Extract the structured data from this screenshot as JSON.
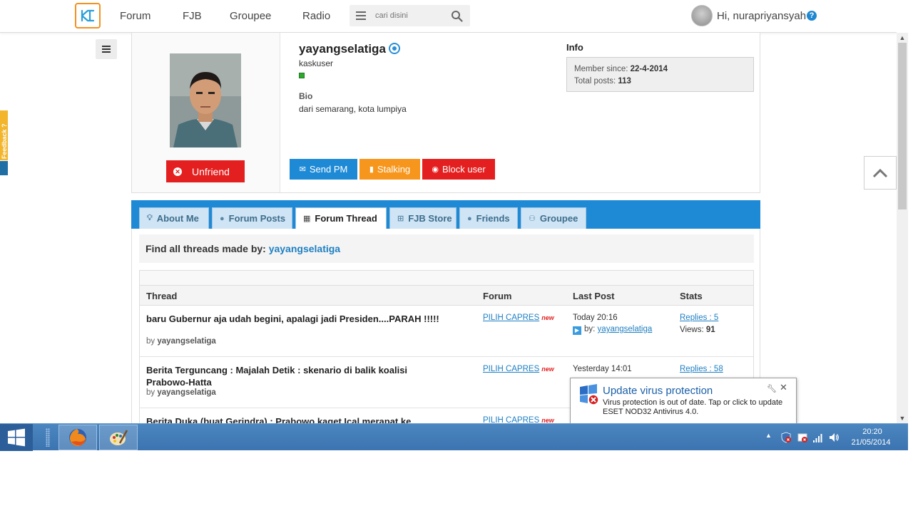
{
  "nav": {
    "forum": "Forum",
    "fjb": "FJB",
    "groupee": "Groupee",
    "radio": "Radio",
    "search_placeholder": "cari disini",
    "greeting": "Hi, nurapriyansyah",
    "help": "?"
  },
  "feedback": {
    "label": "Feedback ?"
  },
  "profile": {
    "name": "yayangselatiga",
    "rank": "kaskuser",
    "bio_label": "Bio",
    "bio": "dari semarang, kota lumpiya",
    "info_label": "Info",
    "member_since_label": "Member since: ",
    "member_since": "22-4-2014",
    "total_posts_label": "Total posts: ",
    "total_posts": "113",
    "unfriend": "Unfriend",
    "send_pm": "Send PM",
    "stalking": "Stalking",
    "block_user": "Block user"
  },
  "tabs": [
    {
      "label": "About Me",
      "icon": "bulb-icon"
    },
    {
      "label": "Forum Posts",
      "icon": "chat-icon"
    },
    {
      "label": "Forum Thread",
      "icon": "calendar-icon",
      "active": true
    },
    {
      "label": "FJB Store",
      "icon": "cart-icon"
    },
    {
      "label": "Friends",
      "icon": "bulb-icon"
    },
    {
      "label": "Groupee",
      "icon": "group-icon"
    }
  ],
  "threads_section": {
    "find_label": "Find all threads made by: ",
    "find_user": "yayangselatiga",
    "columns": [
      "Thread",
      "Forum",
      "Last Post",
      "Stats"
    ],
    "rows": [
      {
        "title": "baru Gubernur aja udah begini, apalagi jadi Presiden....PARAH !!!!!",
        "by_label": "by ",
        "by": "yayangselatiga",
        "forum": "PILIH CAPRES",
        "new": "new",
        "last_date": "Today 20:16",
        "last_by_label": "by: ",
        "last_by": "yayangselatiga",
        "replies": "Replies : 5",
        "views_label": "Views: ",
        "views": "91"
      },
      {
        "title": "Berita Terguncang : Majalah Detik : skenario di balik koalisi Prabowo-Hatta",
        "by_label": "by ",
        "by": "yayangselatiga",
        "forum": "PILIH CAPRES",
        "new": "new",
        "last_date": "Yesterday 14:01",
        "replies": "Replies : 58"
      },
      {
        "title": "Berita Duka (buat Gerindra) : Prabowo kaget Ical merapat ke",
        "forum": "PILIH CAPRES",
        "new": "new"
      }
    ]
  },
  "notification": {
    "title": "Update virus protection",
    "message": "Virus protection is out of date. Tap or click to update ESET NOD32 Antivirus 4.0.",
    "close": "✕"
  },
  "taskbar": {
    "time": "20:20",
    "date": "21/05/2014"
  },
  "colors": {
    "accent_blue": "#1e8ad6",
    "danger_red": "#e41f1f",
    "orange": "#f7961d",
    "logo_orange": "#f29220",
    "taskbar": "#3b74b0"
  }
}
